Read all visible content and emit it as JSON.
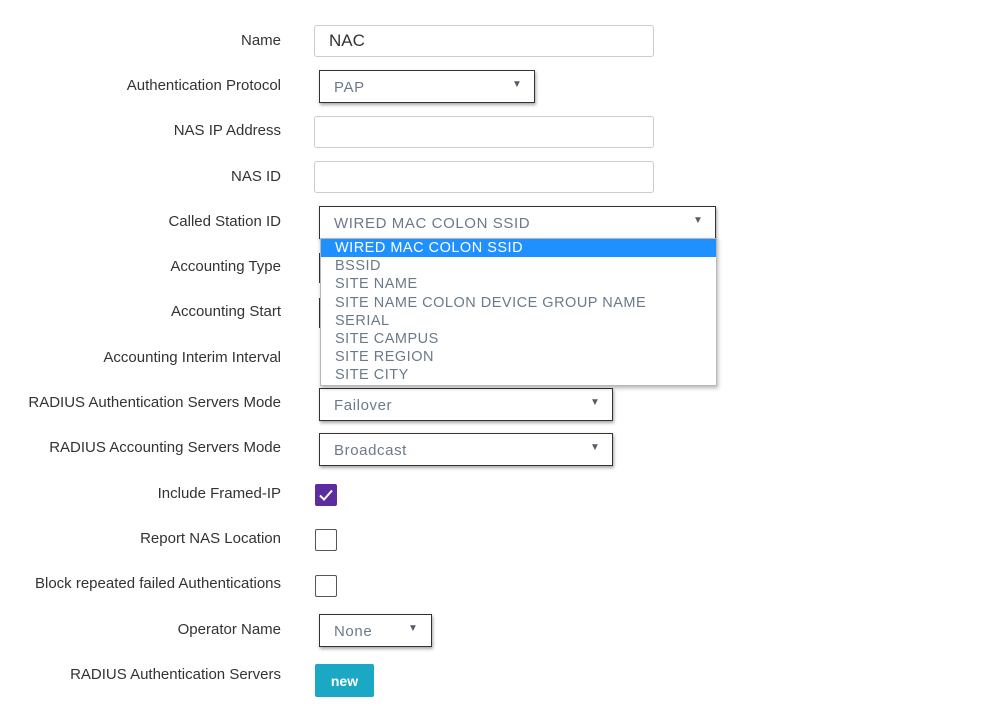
{
  "fields": {
    "name": {
      "label": "Name",
      "value": "NAC"
    },
    "auth_protocol": {
      "label": "Authentication Protocol",
      "value": "PAP"
    },
    "nas_ip": {
      "label": "NAS IP Address",
      "value": ""
    },
    "nas_id": {
      "label": "NAS ID",
      "value": ""
    },
    "called_station_id": {
      "label": "Called Station ID",
      "value": "WIRED MAC COLON SSID",
      "options": [
        "WIRED MAC COLON SSID",
        "BSSID",
        "SITE NAME",
        "SITE NAME COLON DEVICE GROUP NAME",
        "SERIAL",
        "SITE CAMPUS",
        "SITE REGION",
        "SITE CITY"
      ]
    },
    "accounting_type": {
      "label": "Accounting Type"
    },
    "accounting_start": {
      "label": "Accounting Start"
    },
    "accounting_interim": {
      "label": "Accounting Interim Interval"
    },
    "radius_auth_mode": {
      "label": "RADIUS Authentication Servers Mode",
      "value": "Failover"
    },
    "radius_acct_mode": {
      "label": "RADIUS Accounting Servers Mode",
      "value": "Broadcast"
    },
    "include_framed_ip": {
      "label": "Include Framed-IP",
      "checked": true
    },
    "report_nas_location": {
      "label": "Report NAS Location",
      "checked": false
    },
    "block_failed_auth": {
      "label": "Block repeated failed Authentications",
      "checked": false
    },
    "operator_name": {
      "label": "Operator Name",
      "value": "None"
    },
    "radius_auth_servers": {
      "label": "RADIUS Authentication Servers",
      "button_label": "new"
    }
  },
  "colors": {
    "checkbox_checked": "#5b2da0",
    "option_highlight": "#1e90ff",
    "new_button": "#1ba8c4"
  },
  "icons": {
    "caret": "caret-down-icon",
    "check": "checkmark-icon"
  }
}
